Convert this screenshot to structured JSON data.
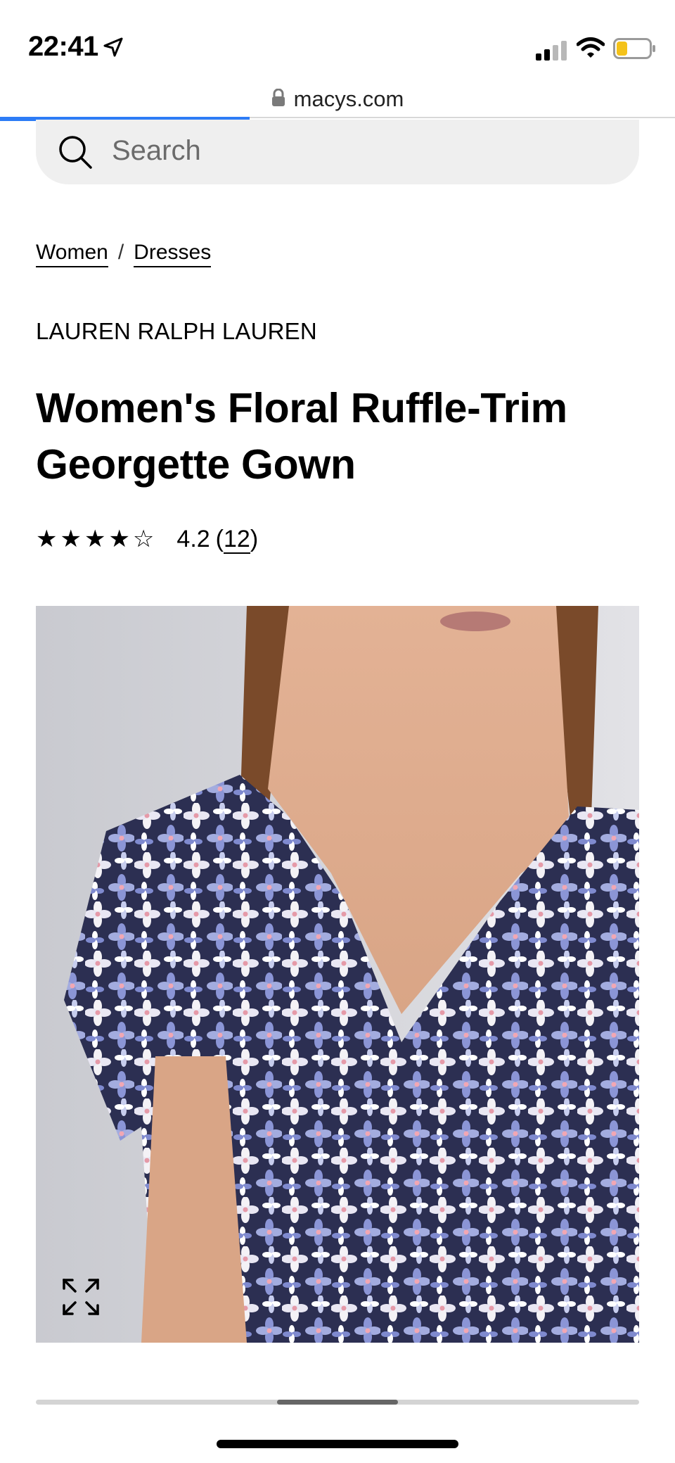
{
  "status_bar": {
    "time": "22:41",
    "battery_level": 0.3,
    "icons": [
      "location-arrow-icon",
      "cellular-signal-icon",
      "wifi-icon",
      "battery-icon"
    ]
  },
  "browser": {
    "url": "macys.com",
    "load_progress": 0.37,
    "icons": [
      "lock-icon"
    ]
  },
  "search": {
    "placeholder": "Search",
    "icon": "search-icon"
  },
  "breadcrumb": {
    "items": [
      "Women",
      "Dresses"
    ],
    "separator": "/"
  },
  "product": {
    "brand": "LAUREN RALPH LAUREN",
    "title": "Women's Floral Ruffle-Trim Georgette Gown",
    "rating": {
      "stars": "★★★★☆",
      "value": "4.2",
      "count_open": "(",
      "count": "12",
      "count_close": ")"
    },
    "image_icon": "expand-icon"
  },
  "carousel": {
    "position": 0.5
  },
  "colors": {
    "progress": "#2d7cf6",
    "sale_red": "#c8102e"
  }
}
